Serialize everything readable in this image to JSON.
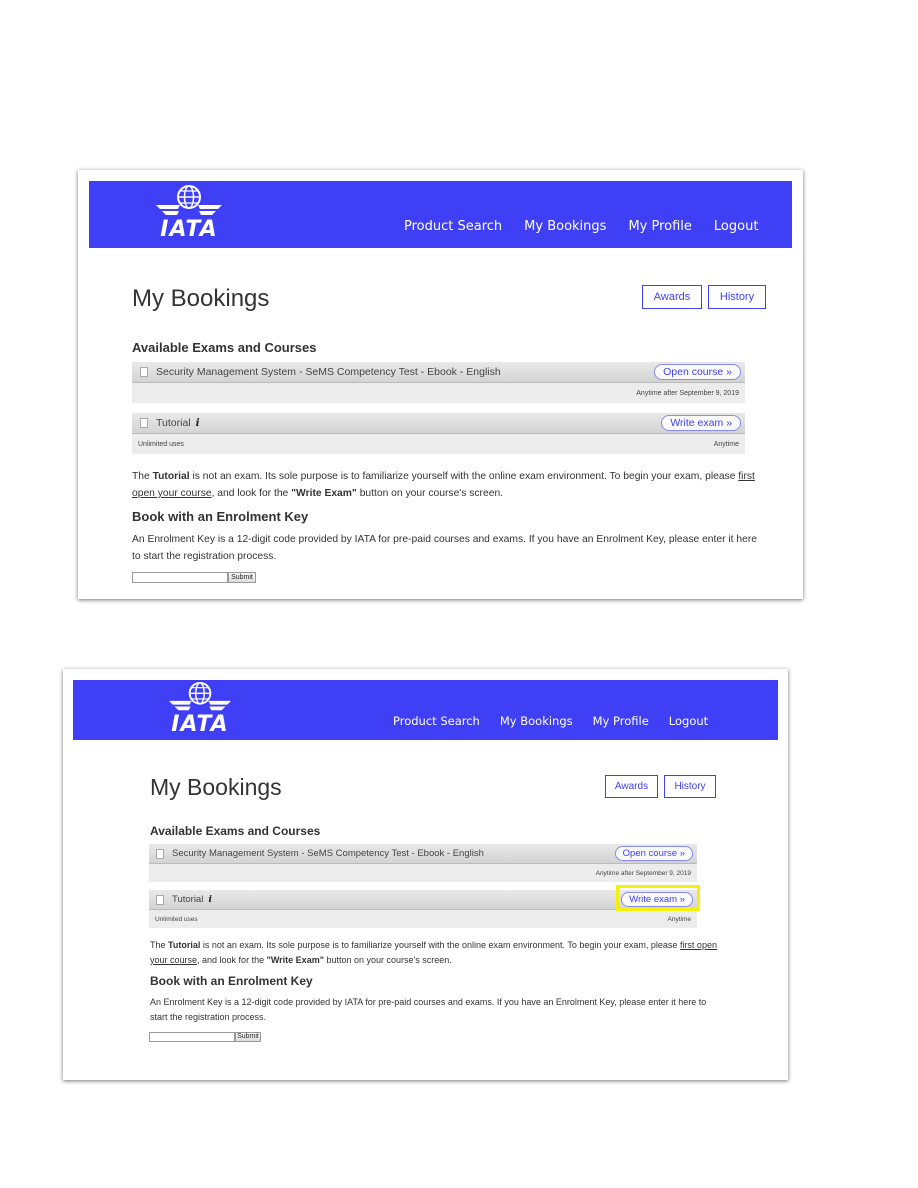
{
  "header": {
    "logo_text": "IATA",
    "nav": [
      "Product Search",
      "My Bookings",
      "My Profile",
      "Logout"
    ],
    "bg_color": "#3f3ff5"
  },
  "page": {
    "title": "My Bookings",
    "awards_label": "Awards",
    "history_label": "History"
  },
  "available": {
    "title": "Available Exams and Courses",
    "courses": [
      {
        "name": "Security Management System - SeMS Competency Test - Ebook - English",
        "action": "Open course »",
        "left_note": "",
        "right_note": "Anytime after September 9, 2019"
      },
      {
        "name": "Tutorial",
        "info_icon": "𝒊",
        "action": "Write exam »",
        "left_note": "Unlimited uses",
        "right_note": "Anytime"
      }
    ]
  },
  "tutorial_note": {
    "prefix": "The ",
    "bold": "Tutorial",
    "middle": " is not an exam. Its sole purpose is to familiarize yourself with the online exam environment. To begin your exam, please ",
    "link": "first open your course",
    "after_link": ", and look for the ",
    "bold2": "\"Write Exam\"",
    "suffix": " button on your course's screen."
  },
  "enrolment": {
    "title": "Book with an Enrolment Key",
    "text": "An Enrolment Key is a 12-digit code provided by IATA for pre-paid courses and exams. If you have an Enrolment Key, please enter it here to start the registration process.",
    "input_value": "",
    "submit_label": "Submit"
  },
  "highlight_color": "#f5f00a"
}
